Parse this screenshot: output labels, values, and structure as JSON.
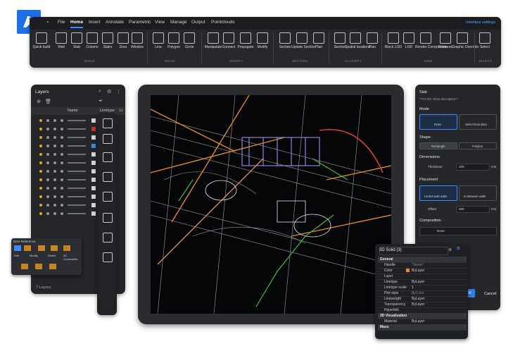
{
  "menu": {
    "items": [
      "File",
      "Home",
      "Insert",
      "Annotate",
      "Parametric",
      "View",
      "Manage",
      "Output",
      "Pointclouds"
    ],
    "active": "Home",
    "interface_settings": "Interface settings"
  },
  "ribbon": {
    "tools": [
      {
        "label": "Quick build",
        "icon": "quick-build-icon"
      },
      {
        "label": "Wall",
        "icon": "wall-icon"
      },
      {
        "label": "Slab",
        "icon": "slab-icon"
      },
      {
        "label": "Column",
        "icon": "column-icon"
      },
      {
        "label": "Stairs",
        "icon": "stairs-icon"
      },
      {
        "label": "Door",
        "icon": "door-icon"
      },
      {
        "label": "Window",
        "icon": "window-icon"
      },
      {
        "label": "Line",
        "icon": "line-icon"
      },
      {
        "label": "Polygon",
        "icon": "polygon-icon"
      },
      {
        "label": "Circle",
        "icon": "circle-icon"
      },
      {
        "label": "Manipulate",
        "icon": "manipulate-icon"
      },
      {
        "label": "Connect",
        "icon": "connect-icon"
      },
      {
        "label": "Propagate",
        "icon": "propagate-icon"
      },
      {
        "label": "Modify",
        "icon": "modify-icon"
      },
      {
        "label": "Section",
        "icon": "section-icon"
      },
      {
        "label": "Update Section",
        "icon": "update-section-icon"
      },
      {
        "label": "Plan",
        "icon": "plan-icon"
      },
      {
        "label": "Section",
        "icon": "section-classify-icon"
      },
      {
        "label": "Spatial locations",
        "icon": "spatial-locations-icon"
      },
      {
        "label": "Plan",
        "icon": "plan-classify-icon"
      },
      {
        "label": "Block LOD",
        "icon": "block-lod-icon"
      },
      {
        "label": "LOD",
        "icon": "lod-icon"
      },
      {
        "label": "Render Composition",
        "icon": "render-composition-icon"
      },
      {
        "label": "Features",
        "icon": "features-icon"
      },
      {
        "label": "Graphic Override",
        "icon": "graphic-override-icon"
      },
      {
        "label": "Select",
        "icon": "select-icon"
      }
    ],
    "groups": [
      "BUILD",
      "DRAW",
      "MODIFY",
      "SECTION",
      "CLASSIFY",
      "VIEW",
      "SELECT"
    ]
  },
  "layers": {
    "title": "Layers",
    "col_name": "Name",
    "col_linetype": "Linetype",
    "col_li": "Li",
    "count": "7 Layers",
    "swatch_colors": [
      "#d0d4da",
      "#c9302c",
      "#d0d4da",
      "#3f86d6",
      "#d0d4da",
      "#d0d4da",
      "#d0d4da",
      "#d0d4da",
      "#d0d4da",
      "#d0d4da",
      "#d0d4da",
      "#d0d4da"
    ]
  },
  "bim": {
    "header": "Bore Reference",
    "labels": [
      "Edit",
      "Modify",
      "Select",
      "3D Constraints"
    ]
  },
  "slab": {
    "title": "Slab",
    "description": "**TO DO: Write description**",
    "mode_label": "Mode",
    "mode_options": [
      "Draw",
      "Select boundary"
    ],
    "shape_label": "Shape",
    "shape_options": [
      "Rectangle",
      "Polyline"
    ],
    "dimensions_label": "Dimensions",
    "thickness_label": "Thickness",
    "thickness_value": "200",
    "thickness_unit": "mm",
    "placement_label": "Placement",
    "placement_options": [
      "Underneath walls",
      "In between walls"
    ],
    "offset_label": "Offset",
    "offset_value": "200",
    "offset_unit": "mm",
    "composition_label": "Composition",
    "composition_value": "None",
    "cancel_label": "Cancel",
    "ok_label": "OK"
  },
  "props": {
    "selection": "3D Solid (3)",
    "categories": {
      "general": "General",
      "viz": "3D Visualization",
      "mass": "Mass"
    },
    "rows": [
      {
        "k": "Handle",
        "v": "*Varies*",
        "dim": true
      },
      {
        "k": "Color",
        "v": "ByLayer"
      },
      {
        "k": "Layer",
        "v": ""
      },
      {
        "k": "Linetype",
        "v": "ByLayer"
      },
      {
        "k": "Linetype scale",
        "v": "1"
      },
      {
        "k": "Plot style",
        "v": "ByColor",
        "dim": true
      },
      {
        "k": "Lineweight",
        "v": "ByLayer"
      },
      {
        "k": "Transparency",
        "v": "ByLayer"
      },
      {
        "k": "Hyperlink",
        "v": ""
      }
    ],
    "material_label": "Material",
    "material_value": "ByLayer",
    "color_swatch": "#e58a1f"
  },
  "colors": {
    "accent": "#3d8bff",
    "brand": "#1d6fe8",
    "bim_orange": "#c4871d"
  }
}
